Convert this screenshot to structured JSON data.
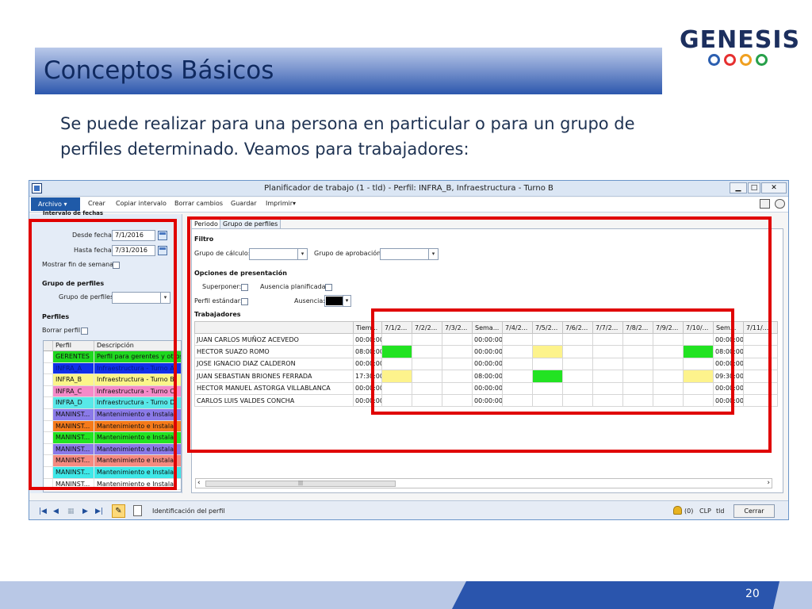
{
  "slide": {
    "title": "Conceptos Básicos",
    "body_line1": "Se puede realizar para una persona en particular o para un grupo de",
    "body_line2": "perfiles determinado. Veamos para trabajadores:",
    "page_number": "20"
  },
  "logo": {
    "text": "GENESIS",
    "ring_colors": [
      "#2c5fb0",
      "#e63030",
      "#f0a020",
      "#27a04a"
    ]
  },
  "window": {
    "title": "Planificador de trabajo (1 - tld) - Perfil: INFRA_B, Infraestructura - Turno B",
    "minimize": "▁",
    "maximize": "□",
    "close": "✕"
  },
  "ribbon": {
    "archivo": "Archivo",
    "items": [
      "Crear",
      "Copiar intervalo",
      "Borrar cambios",
      "Guardar",
      "Imprimir▾"
    ]
  },
  "left_panel": {
    "cut_header": "Intervalo de fechas",
    "desde_label": "Desde fecha:",
    "desde_value": "7/1/2016",
    "hasta_label": "Hasta fecha:",
    "hasta_value": "7/31/2016",
    "mostrar_label": "Mostrar fin de semana:",
    "grupo_header": "Grupo de perfiles",
    "grupo_label": "Grupo de perfiles:",
    "perfiles_header": "Perfiles",
    "borrar_label": "Borrar perfil:",
    "table_headers": [
      "Perfil",
      "Descripción"
    ],
    "profiles": [
      {
        "code": "GERENTES",
        "desc": "Perfil para gerentes y otros",
        "color": "#1fd81f"
      },
      {
        "code": "INFRA_A",
        "desc": "Infraestructura - Turno A",
        "color": "#1030e8"
      },
      {
        "code": "INFRA_B",
        "desc": "Infraestructura - Turno B",
        "color": "#fbf58a"
      },
      {
        "code": "INFRA_C",
        "desc": "Infraestructura - Turno C",
        "color": "#f58ac8"
      },
      {
        "code": "INFRA_D",
        "desc": "Infraestructura - Turno D",
        "color": "#58e8e8"
      },
      {
        "code": "MANINST...",
        "desc": "Mantenimiento e Instalac",
        "color": "#8a7ae8"
      },
      {
        "code": "MANINST...",
        "desc": "Mantenimiento e Instalac",
        "color": "#f57a1a"
      },
      {
        "code": "MANINST...",
        "desc": "Mantenimiento e Instalac",
        "color": "#22e322"
      },
      {
        "code": "MANINST...",
        "desc": "Mantenimiento e Instalac",
        "color": "#8a7ae8"
      },
      {
        "code": "MANINST...",
        "desc": "Mantenimiento e Instalac",
        "color": "#f58a80"
      },
      {
        "code": "MANINST...",
        "desc": "Mantenimiento e Instalac",
        "color": "#3ee8e8"
      },
      {
        "code": "MANINST...",
        "desc": "Mantenimiento e Instalac",
        "color": "#ffffff"
      }
    ]
  },
  "tabs": [
    "Periodo",
    "Grupo de perfiles"
  ],
  "main": {
    "filtro": "Filtro",
    "grupo_calculo": "Grupo de cálculo:",
    "grupo_aprobacion": "Grupo de aprobación:",
    "opciones": "Opciones de presentación",
    "superponer": "Superponer:",
    "ausencia_planificada": "Ausencia planificada:",
    "perfil_estandar": "Perfil estándar:",
    "ausencia": "Ausencia:",
    "trabajadores": "Trabajadores",
    "ausencia_color": "#000000"
  },
  "grid": {
    "headers": [
      "",
      "Tiem...",
      "7/1/2...",
      "7/2/2...",
      "7/3/2...",
      "Sema...",
      "7/4/2...",
      "7/5/2...",
      "7/6/2...",
      "7/7/2...",
      "7/8/2...",
      "7/9/2...",
      "7/10/...",
      "Sem...",
      "7/11/..."
    ],
    "rows": [
      {
        "name": "JUAN CARLOS MUÑOZ ACEVEDO",
        "tiempo": "00:00:00",
        "sema": "00:00:00",
        "sem": "00:00:00",
        "colors": [
          "",
          "",
          "",
          "",
          "",
          "",
          "",
          "",
          "",
          "",
          "",
          "",
          ""
        ]
      },
      {
        "name": "HECTOR SUAZO  ROMO",
        "tiempo": "08:00:00",
        "sema": "00:00:00",
        "sem": "08:00:00",
        "colors": [
          "green",
          "",
          "",
          "",
          "",
          "yellow",
          "",
          "",
          "",
          "",
          "green",
          "",
          ""
        ]
      },
      {
        "name": "JOSE IGNACIO DIAZ CALDERON",
        "tiempo": "00:00:00",
        "sema": "00:00:00",
        "sem": "00:00:00",
        "colors": [
          "",
          "",
          "",
          "",
          "",
          "",
          "",
          "",
          "",
          "",
          "",
          "",
          ""
        ]
      },
      {
        "name": "JUAN SEBASTIAN BRIONES FERRADA",
        "tiempo": "17:30:00",
        "sema": "08:00:00",
        "sem": "09:30:00",
        "colors": [
          "yellow",
          "",
          "",
          "",
          "",
          "green",
          "",
          "",
          "",
          "",
          "yellow",
          "",
          ""
        ]
      },
      {
        "name": "HECTOR MANUEL ASTORGA  VILLABLANCA",
        "tiempo": "00:00:00",
        "sema": "00:00:00",
        "sem": "00:00:00",
        "colors": [
          "",
          "",
          "",
          "",
          "",
          "",
          "",
          "",
          "",
          "",
          "",
          "",
          ""
        ]
      },
      {
        "name": "CARLOS LUIS VALDES  CONCHA",
        "tiempo": "00:00:00",
        "sema": "00:00:00",
        "sem": "00:00:00",
        "colors": [
          "",
          "",
          "",
          "",
          "",
          "",
          "",
          "",
          "",
          "",
          "",
          "",
          ""
        ]
      }
    ]
  },
  "statusbar": {
    "identificacion": "Identificación del perfil",
    "alerts": "(0)",
    "currency": "CLP",
    "company": "tld",
    "close": "Cerrar"
  }
}
